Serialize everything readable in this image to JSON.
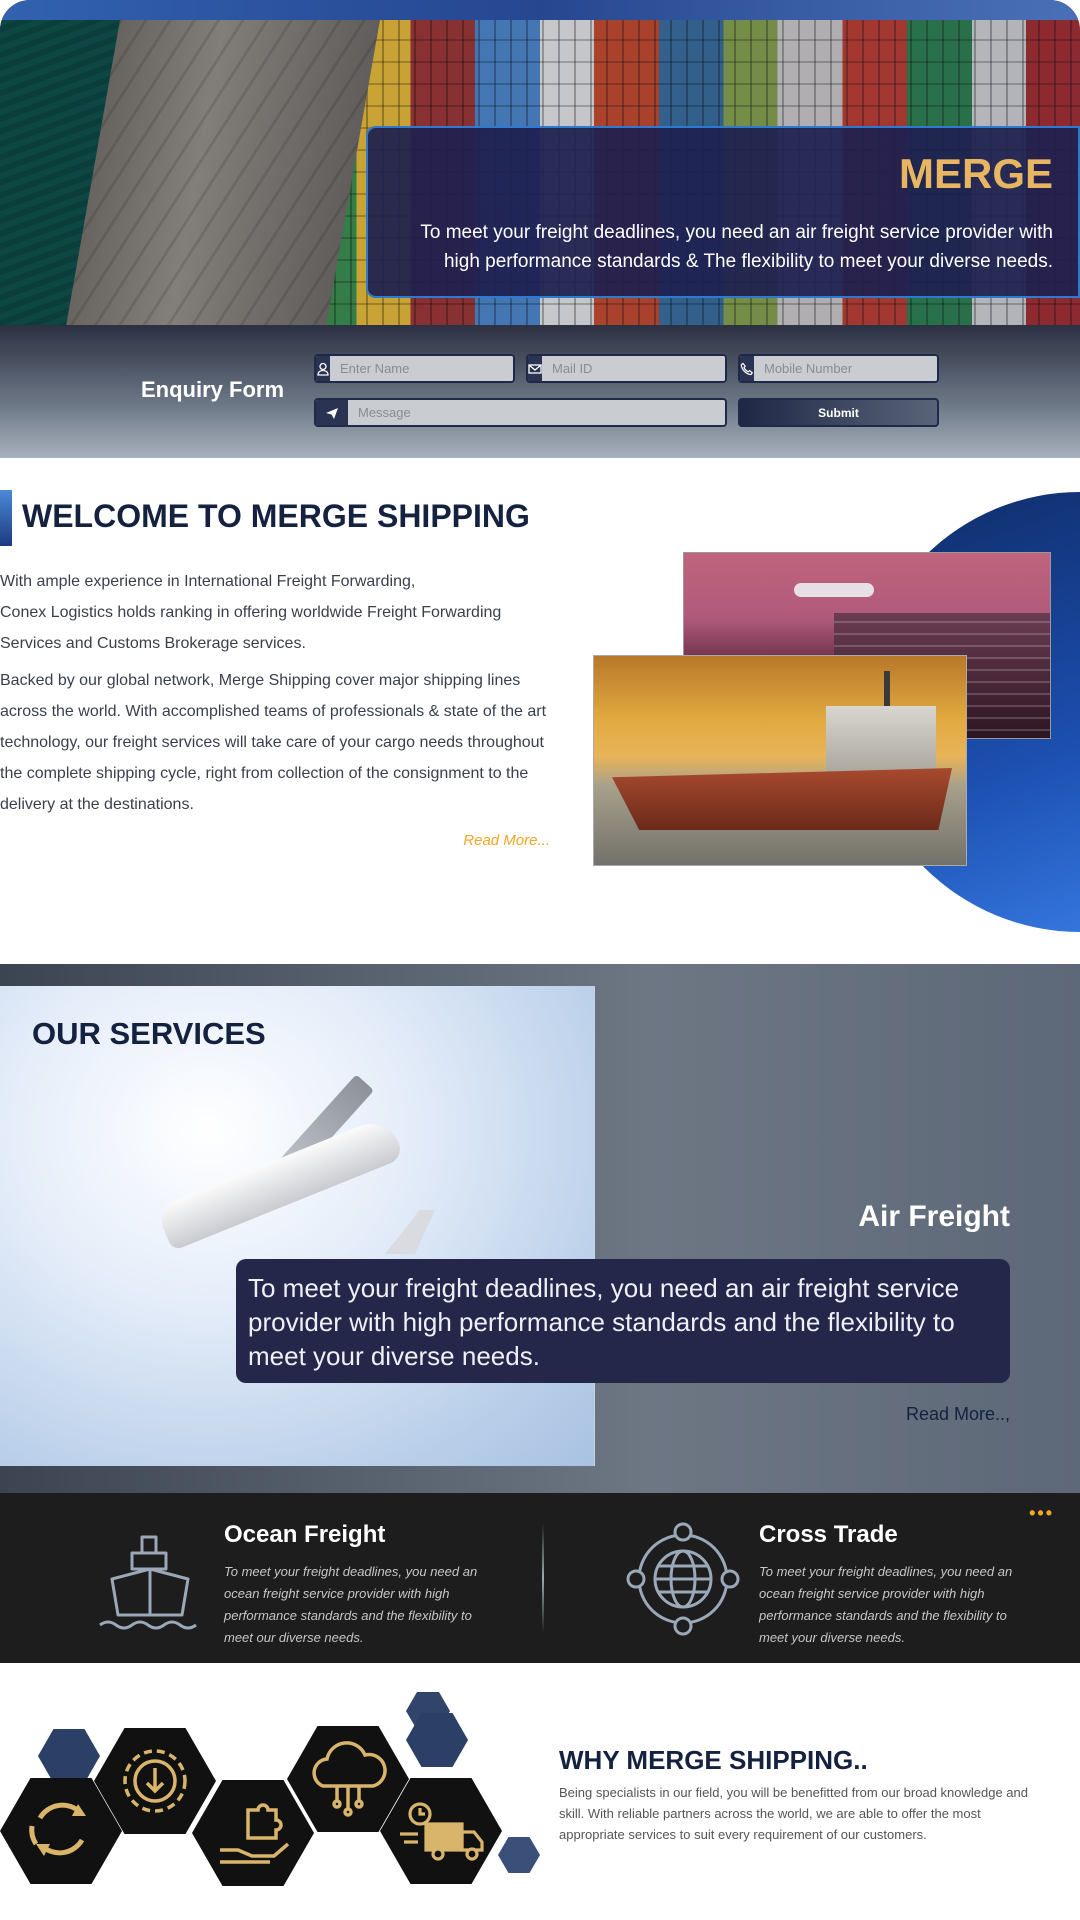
{
  "hero": {
    "title": "MERGE",
    "description": "To meet your freight  deadlines, you need an air freight service provider with high performance standards & The flexibility to meet your diverse needs."
  },
  "enquiry": {
    "title": "Enquiry Form",
    "name_placeholder": "Enter Name",
    "mail_placeholder": "Mail ID",
    "mobile_placeholder": "Mobile Number",
    "message_placeholder": "Message",
    "submit_label": "Submit"
  },
  "welcome": {
    "title": "WELCOME TO MERGE SHIPPING",
    "para1_line1": "With ample experience in International Freight  Forwarding,",
    "para1_line2": "Conex Logistics holds ranking in offering worldwide Freight Forwarding",
    "para1_line3": "Services and Customs Brokerage services.",
    "para2_line1": "Backed by our global network, Merge Shipping cover major shipping lines",
    "para2_line2": "across the world. With accomplished teams of professionals & state of the art",
    "para2_line3": "technology, our freight services will take care of your cargo needs throughout",
    "para2_line4": "the complete shipping cycle, right from collection of the consignment  to the",
    "para2_line5": "delivery at the destinations.",
    "read_more": "Read More..."
  },
  "services": {
    "title": "OUR SERVICES",
    "featured_title": "Air Freight",
    "featured_desc": "To meet your freight  deadlines, you need an air freight service provider with high performance standards and the flexibility to meet your diverse needs.",
    "read_more": "Read More..,",
    "more_dots": "•••",
    "items": [
      {
        "title": "Ocean Freight",
        "desc": "To meet your freight deadlines, you need an ocean freight service provider with high performance standards and the flexibility to meet our diverse needs.",
        "icon": "ship-icon"
      },
      {
        "title": "Cross Trade",
        "desc": "To meet your freight deadlines, you need an ocean freight service provider with high performance standards and the flexibility to meet your diverse needs.",
        "icon": "globe-icon"
      }
    ]
  },
  "why": {
    "title": "WHY MERGE SHIPPING..",
    "desc": "Being specialists in our field, you will be benefitted from our broad knowledge and skill. With reliable partners across the world, we are able to offer the most appropriate services to suit every requirement of our customers.",
    "icons": [
      "refresh-icon",
      "gear-download-icon",
      "hand-puzzle-icon",
      "cloud-network-icon",
      "delivery-truck-icon"
    ]
  },
  "colors": {
    "navy": "#14213f",
    "accent_gold": "#e8b661",
    "accent_orange": "#f5a623",
    "accent_blue": "#2e7ad1"
  }
}
